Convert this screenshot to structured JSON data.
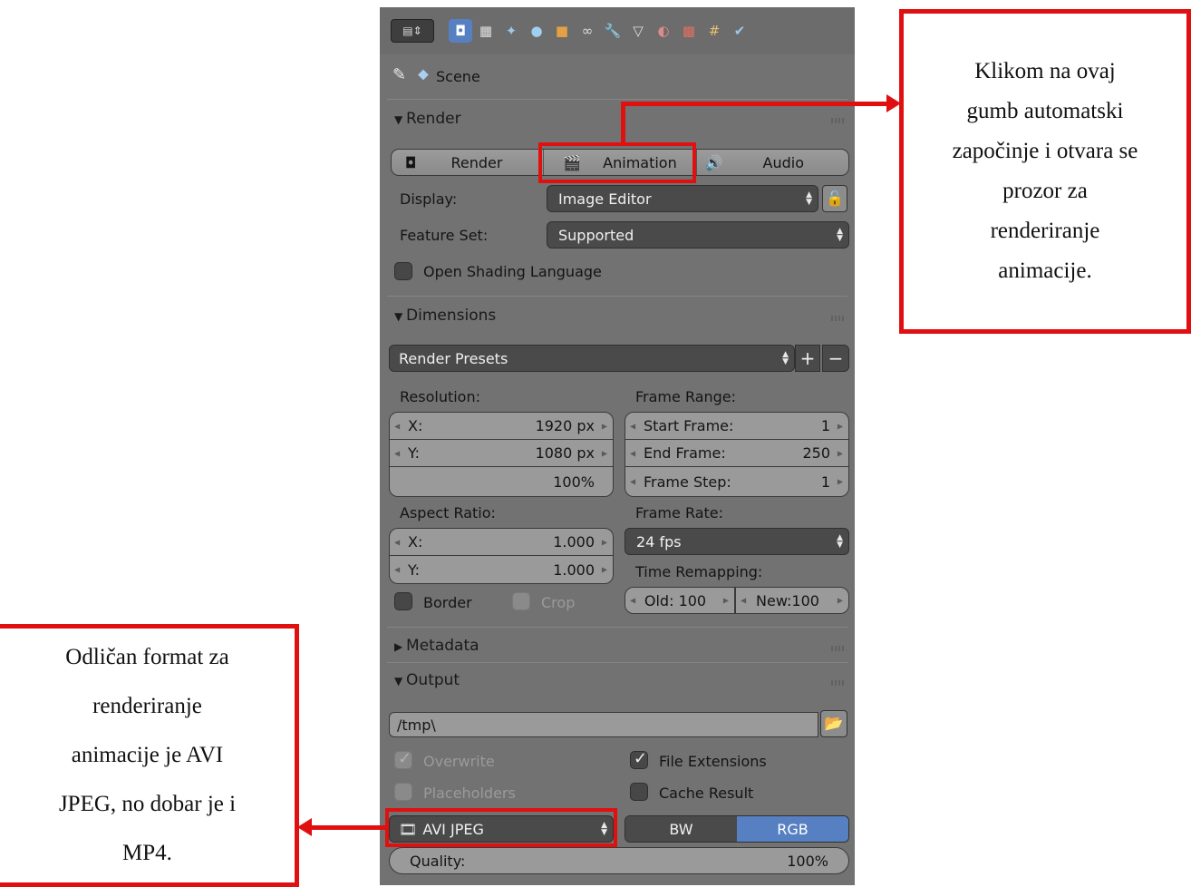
{
  "scene": {
    "label": "Scene"
  },
  "render": {
    "header": "Render",
    "render_btn": "Render",
    "animation_btn": "Animation",
    "audio_btn": "Audio",
    "display_label": "Display:",
    "display_value": "Image Editor",
    "feature_label": "Feature Set:",
    "feature_value": "Supported",
    "osl_label": "Open Shading Language"
  },
  "dimensions": {
    "header": "Dimensions",
    "presets": "Render Presets",
    "resolution_label": "Resolution:",
    "res_x_label": "X:",
    "res_x": "1920 px",
    "res_y_label": "Y:",
    "res_y": "1080 px",
    "res_pct": "100%",
    "frame_range_label": "Frame Range:",
    "start_label": "Start Frame:",
    "start": "1",
    "end_label": "End Frame:",
    "end": "250",
    "step_label": "Frame Step:",
    "step": "1",
    "aspect_label": "Aspect Ratio:",
    "asp_x_label": "X:",
    "asp_x": "1.000",
    "asp_y_label": "Y:",
    "asp_y": "1.000",
    "frame_rate_label": "Frame Rate:",
    "frame_rate": "24 fps",
    "time_remap_label": "Time Remapping:",
    "old": "Old: 100",
    "new": "New:100",
    "border_label": "Border",
    "crop_label": "Crop"
  },
  "metadata": {
    "header": "Metadata"
  },
  "output": {
    "header": "Output",
    "path": "/tmp\\",
    "overwrite": "Overwrite",
    "file_ext": "File Extensions",
    "placeholders": "Placeholders",
    "cache": "Cache Result",
    "format": "AVI JPEG",
    "bw": "BW",
    "rgb": "RGB",
    "quality_label": "Quality:",
    "quality": "100%"
  },
  "notes": {
    "right_lines": [
      "Klikom na ovaj",
      "gumb automatski",
      "započinje i otvara se",
      "prozor za",
      "renderiranje",
      "animacije."
    ],
    "left_lines": [
      "Odličan format za",
      "renderiranje",
      "animacije je AVI",
      "JPEG, no dobar je i",
      "MP4."
    ]
  },
  "colors": {
    "annotation": "#e01010",
    "selected": "#5680c2",
    "panel": "#727272"
  }
}
